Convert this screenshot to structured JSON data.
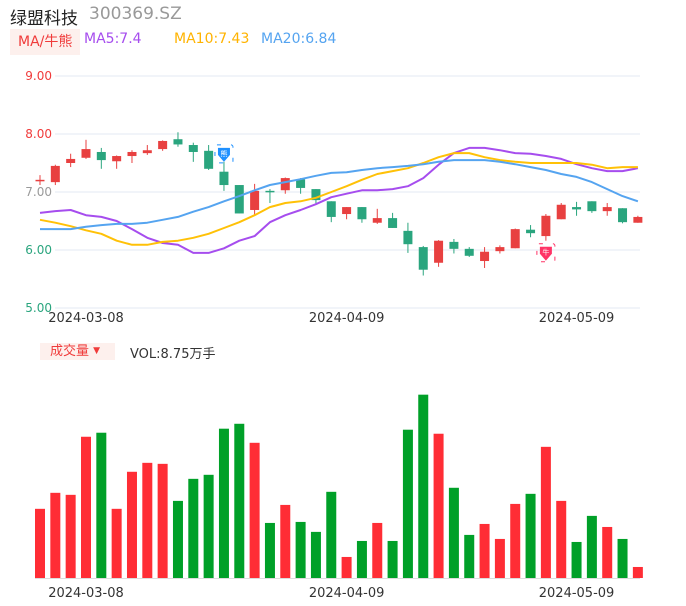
{
  "header": {
    "name": "绿盟科技",
    "code": "300369.SZ"
  },
  "legend": {
    "ma_button": "MA/牛熊",
    "ma5": "MA5:7.4",
    "ma10": "MA10:7.43",
    "ma20": "MA20:6.84"
  },
  "volume_panel": {
    "button": "成交量",
    "vol_label": "VOL:8.75万手"
  },
  "markers": {
    "bear": "熊",
    "bull": "牛"
  },
  "colors": {
    "up": "#e84040",
    "down": "#2aa57e",
    "vol_up": "#ff2d35",
    "vol_down": "#00a028",
    "ma5": "#a64dee",
    "ma10": "#ffc107",
    "ma20": "#55a4f0"
  },
  "chart_data": {
    "type": "candlestick",
    "y_ticks": [
      "9.00",
      "8.00",
      "7.00",
      "6.00",
      "5.00"
    ],
    "ylim": [
      5,
      9
    ],
    "x_tick_labels": [
      {
        "index": 3,
        "label": "2024-03-08"
      },
      {
        "index": 20,
        "label": "2024-04-09"
      },
      {
        "index": 35,
        "label": "2024-05-09"
      }
    ],
    "ohlc": [
      [
        7.2,
        7.29,
        7.12,
        7.21
      ],
      [
        7.17,
        7.47,
        7.12,
        7.45
      ],
      [
        7.5,
        7.66,
        7.43,
        7.57
      ],
      [
        7.59,
        7.9,
        7.57,
        7.74
      ],
      [
        7.69,
        7.76,
        7.4,
        7.55
      ],
      [
        7.53,
        7.63,
        7.4,
        7.62
      ],
      [
        7.62,
        7.72,
        7.5,
        7.69
      ],
      [
        7.67,
        7.81,
        7.64,
        7.72
      ],
      [
        7.74,
        7.89,
        7.71,
        7.88
      ],
      [
        7.91,
        8.03,
        7.78,
        7.82
      ],
      [
        7.81,
        7.85,
        7.52,
        7.69
      ],
      [
        7.71,
        7.81,
        7.38,
        7.4
      ],
      [
        7.35,
        7.52,
        7.02,
        7.12
      ],
      [
        7.12,
        7.12,
        6.63,
        6.63
      ],
      [
        6.69,
        7.14,
        6.6,
        7.02
      ],
      [
        7.02,
        7.05,
        6.81,
        7.0
      ],
      [
        7.03,
        7.25,
        6.97,
        7.24
      ],
      [
        7.22,
        7.24,
        6.97,
        7.07
      ],
      [
        7.05,
        7.05,
        6.78,
        6.86
      ],
      [
        6.84,
        6.84,
        6.48,
        6.57
      ],
      [
        6.62,
        6.74,
        6.53,
        6.74
      ],
      [
        6.74,
        6.74,
        6.47,
        6.53
      ],
      [
        6.47,
        6.71,
        6.45,
        6.55
      ],
      [
        6.55,
        6.64,
        6.38,
        6.38
      ],
      [
        6.33,
        6.47,
        5.95,
        6.1
      ],
      [
        6.05,
        6.07,
        5.56,
        5.66
      ],
      [
        5.78,
        6.17,
        5.71,
        6.16
      ],
      [
        6.14,
        6.19,
        5.94,
        6.02
      ],
      [
        6.02,
        6.05,
        5.88,
        5.9
      ],
      [
        5.81,
        6.05,
        5.69,
        5.97
      ],
      [
        5.98,
        6.08,
        5.94,
        6.05
      ],
      [
        6.03,
        6.37,
        6.03,
        6.36
      ],
      [
        6.35,
        6.43,
        6.22,
        6.29
      ],
      [
        6.24,
        6.62,
        6.16,
        6.59
      ],
      [
        6.53,
        6.81,
        6.53,
        6.78
      ],
      [
        6.74,
        6.83,
        6.59,
        6.7
      ],
      [
        6.84,
        6.84,
        6.64,
        6.67
      ],
      [
        6.67,
        6.81,
        6.59,
        6.74
      ],
      [
        6.72,
        6.72,
        6.46,
        6.48
      ],
      [
        6.47,
        6.59,
        6.47,
        6.57
      ]
    ],
    "series": [
      {
        "name": "MA5",
        "values": [
          6.64,
          6.67,
          6.69,
          6.6,
          6.57,
          6.5,
          6.36,
          6.21,
          6.12,
          6.09,
          5.95,
          5.95,
          6.03,
          6.16,
          6.24,
          6.48,
          6.6,
          6.69,
          6.79,
          6.91,
          6.97,
          7.03,
          7.03,
          7.05,
          7.1,
          7.24,
          7.47,
          7.67,
          7.76,
          7.76,
          7.72,
          7.67,
          7.66,
          7.62,
          7.57,
          7.48,
          7.41,
          7.36,
          7.36,
          7.41
        ]
      },
      {
        "name": "MA10",
        "values": [
          6.52,
          6.47,
          6.41,
          6.34,
          6.28,
          6.16,
          6.09,
          6.09,
          6.14,
          6.16,
          6.21,
          6.28,
          6.38,
          6.48,
          6.6,
          6.74,
          6.81,
          6.84,
          6.9,
          7.0,
          7.1,
          7.21,
          7.31,
          7.36,
          7.41,
          7.5,
          7.6,
          7.67,
          7.67,
          7.6,
          7.55,
          7.52,
          7.5,
          7.5,
          7.5,
          7.5,
          7.47,
          7.41,
          7.43,
          7.43
        ]
      },
      {
        "name": "MA20",
        "values": [
          6.36,
          6.36,
          6.36,
          6.4,
          6.43,
          6.45,
          6.45,
          6.47,
          6.52,
          6.57,
          6.66,
          6.74,
          6.84,
          6.93,
          7.03,
          7.12,
          7.17,
          7.22,
          7.28,
          7.33,
          7.34,
          7.38,
          7.41,
          7.43,
          7.45,
          7.48,
          7.52,
          7.55,
          7.55,
          7.55,
          7.52,
          7.48,
          7.43,
          7.38,
          7.31,
          7.26,
          7.17,
          7.05,
          6.93,
          6.84
        ]
      }
    ],
    "volume": {
      "unit": "万手",
      "ylim": [
        0,
        150
      ],
      "values": [
        54.9,
        67.6,
        66.0,
        112.1,
        115.3,
        54.9,
        84.3,
        91.4,
        90.6,
        61.2,
        78.7,
        81.9,
        118.5,
        122.4,
        107.3,
        43.7,
        58.0,
        44.5,
        36.6,
        68.4,
        16.7,
        29.4,
        43.7,
        29.4,
        117.7,
        145.5,
        114.5,
        71.6,
        34.2,
        42.9,
        31.0,
        58.8,
        66.8,
        104.1,
        61.2,
        28.6,
        49.3,
        40.5,
        31.0,
        8.75
      ]
    },
    "signals": [
      {
        "index": 12,
        "type": "bear"
      },
      {
        "index": 33,
        "type": "bull"
      }
    ]
  }
}
